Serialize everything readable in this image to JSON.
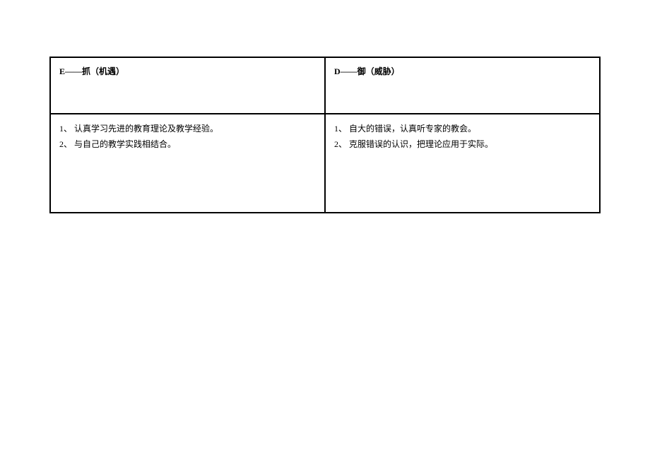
{
  "table": {
    "headers": {
      "left": "E——抓（机遇）",
      "right": "D——御（威胁）"
    },
    "content": {
      "left": {
        "item1": "1、 认真学习先进的教育理论及教学经验。",
        "item2": "2、 与自己的教学实践相结合。"
      },
      "right": {
        "item1": "1、 自大的错误，认真听专家的教会。",
        "item2": "2、 克服错误的认识，把理论应用于实际。"
      }
    }
  }
}
